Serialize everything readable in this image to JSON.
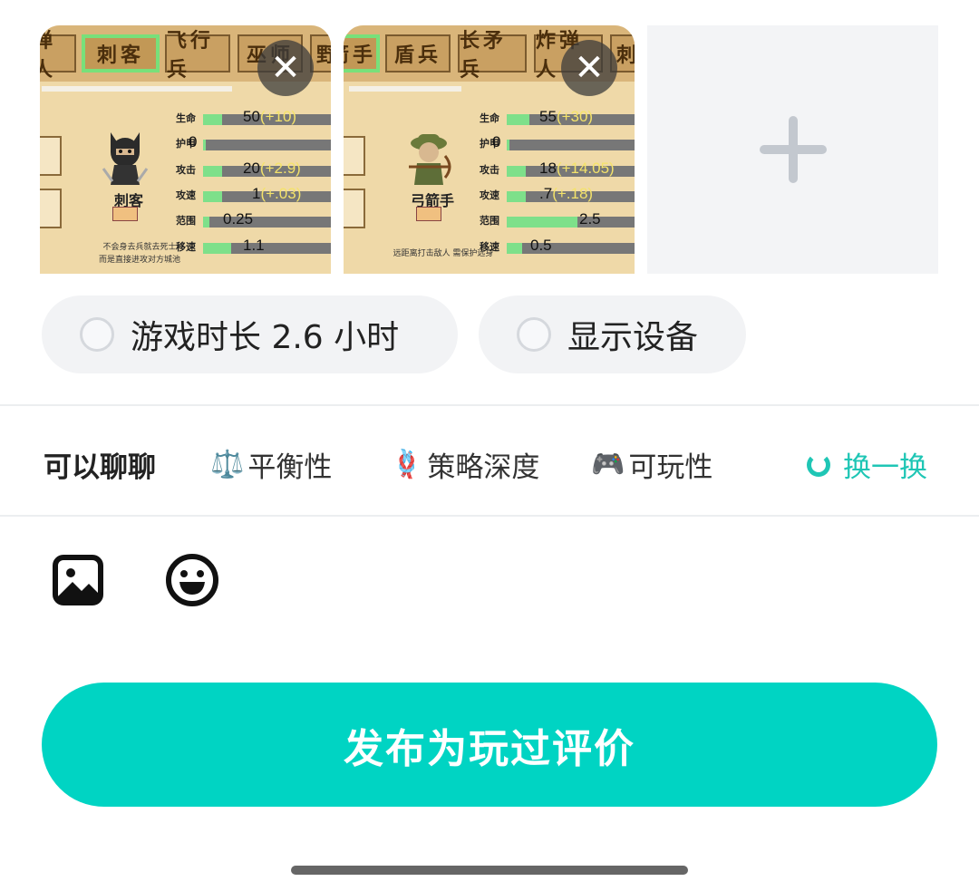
{
  "thumbnails": [
    {
      "tabs": [
        "弹人",
        "刺客",
        "飞行兵",
        "巫师",
        "野"
      ],
      "selected_tab": 1,
      "character_name": "刺客",
      "description_lines": [
        "不会身去兵就去死士",
        "而是直接进攻对方城池"
      ],
      "stats": [
        {
          "label": "生命",
          "value": "50",
          "bonus": "(+10)",
          "fill": 0.15
        },
        {
          "label": "护甲",
          "value": "0",
          "bonus": "",
          "fill": 0.02
        },
        {
          "label": "攻击",
          "value": "20",
          "bonus": "(+2.9)",
          "fill": 0.15
        },
        {
          "label": "攻速",
          "value": "1",
          "bonus": "(+.03)",
          "fill": 0.15
        },
        {
          "label": "范围",
          "value": "0.25",
          "bonus": "",
          "fill": 0.05
        },
        {
          "label": "移速",
          "value": "1.1",
          "bonus": "",
          "fill": 0.22
        }
      ]
    },
    {
      "tabs": [
        "箭手",
        "盾兵",
        "长矛兵",
        "炸弹人",
        "刺"
      ],
      "selected_tab": 0,
      "character_name": "弓箭手",
      "description_lines": [
        "远距离打击敌人 需保护远身"
      ],
      "stats": [
        {
          "label": "生命",
          "value": "55",
          "bonus": "(+30)",
          "fill": 0.18
        },
        {
          "label": "护甲",
          "value": "0",
          "bonus": "",
          "fill": 0.02
        },
        {
          "label": "攻击",
          "value": "18",
          "bonus": "(+14.05)",
          "fill": 0.15
        },
        {
          "label": "攻速",
          "value": ".7",
          "bonus": "(+.18)",
          "fill": 0.15
        },
        {
          "label": "范围",
          "value": "2.5",
          "bonus": "",
          "fill": 0.55
        },
        {
          "label": "移速",
          "value": "0.5",
          "bonus": "",
          "fill": 0.12
        }
      ]
    }
  ],
  "options": {
    "play_time": "游戏时长 2.6 小时",
    "show_device": "显示设备"
  },
  "topics": {
    "title": "可以聊聊",
    "items": [
      {
        "emoji": "⚖️",
        "label": "平衡性"
      },
      {
        "emoji": "🪢",
        "label": "策略深度"
      },
      {
        "emoji": "🎮",
        "label": "可玩性"
      }
    ],
    "refresh_label": "换一换"
  },
  "publish_label": "发布为玩过评价",
  "colors": {
    "accent": "#00d4c3",
    "refresh_text": "#1fc6b5",
    "chip_bg": "#f2f3f5"
  }
}
